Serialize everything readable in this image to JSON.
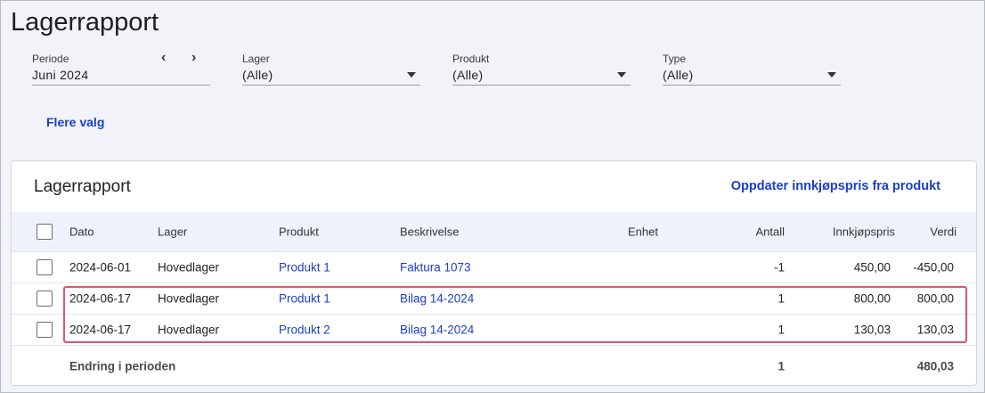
{
  "page": {
    "title": "Lagerrapport"
  },
  "filters": {
    "period": {
      "label": "Periode",
      "value": "Juni 2024",
      "prev_icon": "chevron-left-icon",
      "next_icon": "chevron-right-icon"
    },
    "warehouse": {
      "label": "Lager",
      "value": "(Alle)"
    },
    "product": {
      "label": "Produkt",
      "value": "(Alle)"
    },
    "type": {
      "label": "Type",
      "value": "(Alle)"
    },
    "more_options": "Flere valg"
  },
  "report": {
    "title": "Lagerrapport",
    "action": "Oppdater innkjøpspris fra produkt",
    "columns": [
      "Dato",
      "Lager",
      "Produkt",
      "Beskrivelse",
      "Enhet",
      "Antall",
      "Innkjøpspris",
      "Verdi"
    ],
    "rows": [
      {
        "date": "2024-06-01",
        "warehouse": "Hovedlager",
        "product": "Produkt 1",
        "description": "Faktura 1073",
        "unit": "",
        "quantity": "-1",
        "price": "450,00",
        "value": "-450,00"
      },
      {
        "date": "2024-06-17",
        "warehouse": "Hovedlager",
        "product": "Produkt 1",
        "description": "Bilag 14-2024",
        "unit": "",
        "quantity": "1",
        "price": "800,00",
        "value": "800,00"
      },
      {
        "date": "2024-06-17",
        "warehouse": "Hovedlager",
        "product": "Produkt 2",
        "description": "Bilag 14-2024",
        "unit": "",
        "quantity": "1",
        "price": "130,03",
        "value": "130,03"
      }
    ],
    "summary": {
      "label": "Endring i perioden",
      "quantity": "1",
      "value": "480,03"
    }
  },
  "colors": {
    "accent": "#1a3fc9",
    "highlight": "#e0556b",
    "header_bg": "#eef2fb"
  }
}
